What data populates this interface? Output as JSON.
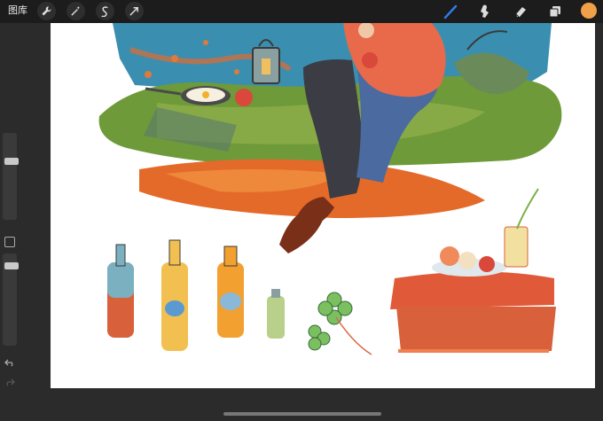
{
  "topbar": {
    "gallery_label": "图库",
    "left_tools": [
      {
        "icon": "wrench-icon"
      },
      {
        "icon": "magic-wand-icon"
      },
      {
        "icon": "selection-icon"
      },
      {
        "icon": "transform-arrow-icon"
      }
    ],
    "right_tools": [
      {
        "icon": "brush-icon",
        "active": true
      },
      {
        "icon": "smudge-icon"
      },
      {
        "icon": "eraser-icon"
      },
      {
        "icon": "layers-icon"
      }
    ],
    "current_color": "#f0a048",
    "brush_accent": "#2f7df0"
  },
  "sidebar": {
    "controls": [
      "brush-size-slider",
      "modify-button",
      "opacity-slider",
      "undo-icon",
      "redo-icon"
    ]
  },
  "canvas": {
    "artwork": "illustration-picnic-scene"
  }
}
